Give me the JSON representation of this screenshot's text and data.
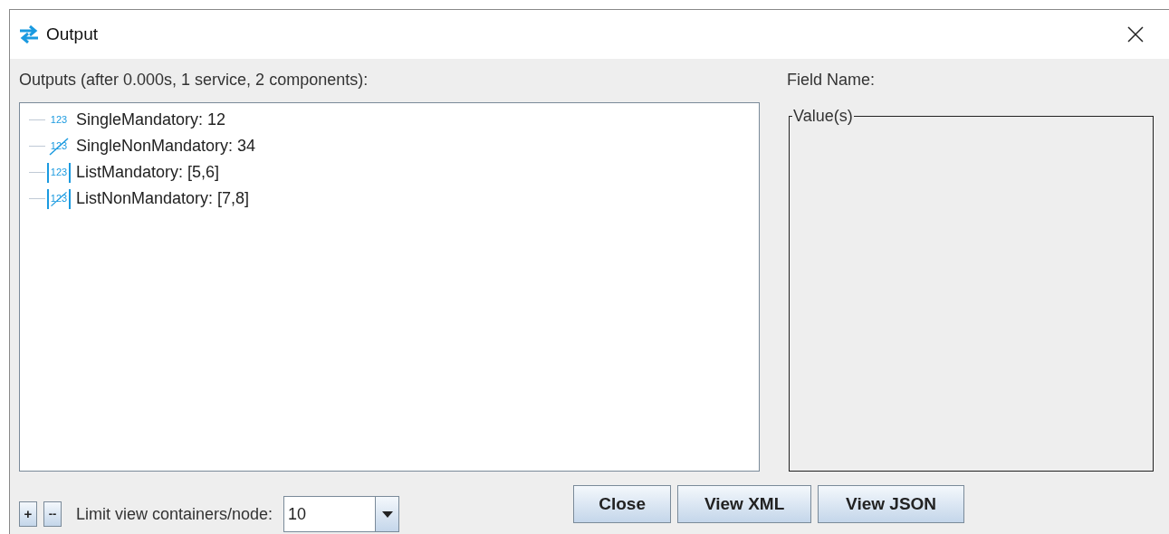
{
  "window": {
    "title": "Output"
  },
  "outputs_label": "Outputs (after 0.000s, 1 service, 2 components):",
  "tree": [
    {
      "kind": "single",
      "mandatory": true,
      "icon_label": "123",
      "label": "SingleMandatory: 12"
    },
    {
      "kind": "single",
      "mandatory": false,
      "icon_label": "123",
      "label": "SingleNonMandatory: 34"
    },
    {
      "kind": "list",
      "mandatory": true,
      "icon_label": "123",
      "label": "ListMandatory: [5,6]"
    },
    {
      "kind": "list",
      "mandatory": false,
      "icon_label": "123",
      "label": "ListNonMandatory: [7,8]"
    }
  ],
  "field_name_label": "Field Name:",
  "values_group": {
    "title": "Value(s)"
  },
  "expand_button": "+",
  "collapse_button": "--",
  "limit_label": "Limit view containers/node:",
  "limit_select": {
    "value": "10"
  },
  "buttons": [
    "Close",
    "View XML",
    "View JSON"
  ]
}
